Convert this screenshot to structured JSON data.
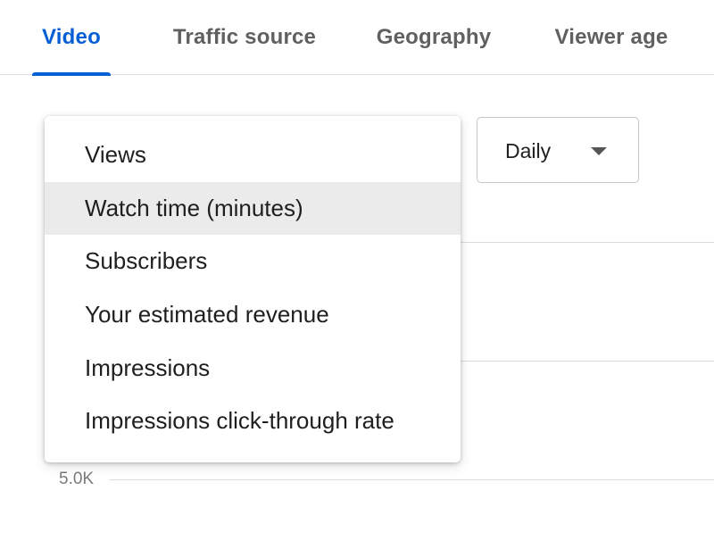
{
  "tabs": [
    {
      "label": "Video",
      "active": true
    },
    {
      "label": "Traffic source",
      "active": false
    },
    {
      "label": "Geography",
      "active": false
    },
    {
      "label": "Viewer age",
      "active": false
    }
  ],
  "period_select": {
    "value": "Daily",
    "icon": "caret-down-icon"
  },
  "metric_menu": {
    "items": [
      {
        "label": "Views"
      },
      {
        "label": "Watch time (minutes)",
        "highlighted": true
      },
      {
        "label": "Subscribers"
      },
      {
        "label": "Your estimated revenue"
      },
      {
        "label": "Impressions"
      },
      {
        "label": "Impressions click-through rate"
      }
    ]
  },
  "chart": {
    "y_tick_label": "5.0K"
  },
  "colors": {
    "accent": "#065fd4",
    "tab_inactive": "#606060",
    "menu_highlight": "#ebebeb"
  }
}
